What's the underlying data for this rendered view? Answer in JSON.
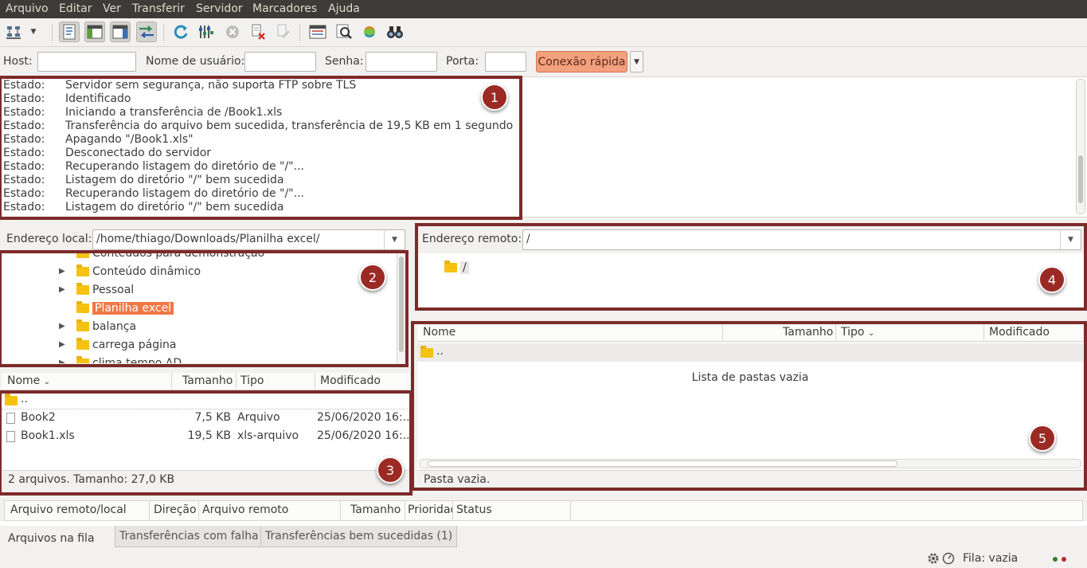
{
  "menu": [
    "Arquivo",
    "Editar",
    "Ver",
    "Transferir",
    "Servidor",
    "Marcadores",
    "Ajuda"
  ],
  "toolbar": {
    "buttons": [
      "site-manager",
      "dropdown",
      "toggle-log",
      "toggle-local-tree",
      "toggle-remote-tree",
      "toggle-queue",
      "refresh",
      "process-queue",
      "cancel",
      "disconnect",
      "reconnect",
      "dir-listing-filter",
      "compare",
      "sync-browse",
      "search"
    ]
  },
  "quickconnect": {
    "host_label": "Host:",
    "host_value": "",
    "user_label": "Nome de usuário:",
    "user_value": "",
    "pass_label": "Senha:",
    "pass_value": "",
    "port_label": "Porta:",
    "port_value": "",
    "button": "Conexão rápida"
  },
  "log": [
    {
      "k": "Estado:",
      "t": "Servidor sem segurança, não suporta FTP sobre TLS"
    },
    {
      "k": "Estado:",
      "t": "Identificado"
    },
    {
      "k": "Estado:",
      "t": "Iniciando a transferência de /Book1.xls"
    },
    {
      "k": "Estado:",
      "t": "Transferência do arquivo bem sucedida, transferência de 19,5 KB em 1 segundo"
    },
    {
      "k": "Estado:",
      "t": "Apagando \"/Book1.xls\""
    },
    {
      "k": "Estado:",
      "t": "Desconectado do servidor"
    },
    {
      "k": "Estado:",
      "t": "Recuperando listagem do diretório de \"/\"..."
    },
    {
      "k": "Estado:",
      "t": "Listagem do diretório \"/\" bem sucedida"
    },
    {
      "k": "Estado:",
      "t": "Recuperando listagem do diretório de \"/\"..."
    },
    {
      "k": "Estado:",
      "t": "Listagem do diretório \"/\" bem sucedida"
    }
  ],
  "local": {
    "address_label": "Endereço local:",
    "address_value": "/home/thiago/Downloads/Planilha excel/",
    "tree": [
      {
        "label": "Conteúdos para demonstração",
        "arrow": false,
        "selected": false
      },
      {
        "label": "Conteúdo dinâmico",
        "arrow": true,
        "selected": false
      },
      {
        "label": "Pessoal",
        "arrow": true,
        "selected": false
      },
      {
        "label": "Planilha excel",
        "arrow": false,
        "selected": true
      },
      {
        "label": "balança",
        "arrow": true,
        "selected": false
      },
      {
        "label": "carrega página",
        "arrow": true,
        "selected": false
      },
      {
        "label": "clima tempo AD",
        "arrow": true,
        "selected": false
      }
    ],
    "columns": [
      "Nome",
      "Tamanho",
      "Tipo",
      "Modificado"
    ],
    "files": [
      {
        "name": "..",
        "size": "",
        "type": "",
        "modified": "",
        "kind": "folder"
      },
      {
        "name": "Book2",
        "size": "7,5 KB",
        "type": "Arquivo",
        "modified": "25/06/2020 16:...",
        "kind": "file"
      },
      {
        "name": "Book1.xls",
        "size": "19,5 KB",
        "type": "xls-arquivo",
        "modified": "25/06/2020 16:...",
        "kind": "file"
      }
    ],
    "status": "2 arquivos. Tamanho: 27,0 KB"
  },
  "remote": {
    "address_label": "Endereço remoto:",
    "address_value": "/",
    "tree_root": "/",
    "columns": [
      "Nome",
      "Tamanho",
      "Tipo",
      "Modificado"
    ],
    "files": [
      {
        "name": "..",
        "kind": "folder"
      }
    ],
    "empty_message": "Lista de pastas vazia",
    "status": "Pasta vazia."
  },
  "annotations": [
    "1",
    "2",
    "3",
    "4",
    "5"
  ],
  "queue": {
    "columns": [
      "Arquivo remoto/local",
      "Direção",
      "Arquivo remoto",
      "Tamanho",
      "Prioridade",
      "Status"
    ],
    "tabs": [
      "Arquivos na fila",
      "Transferências com falha",
      "Transferências bem sucedidas (1)"
    ]
  },
  "statusbar": {
    "queue": "Fila: vazia"
  },
  "colors": {
    "menubar": "#3c3b37",
    "accent_selection": "#f07746",
    "annotation": "#7d2a2a",
    "badge": "#9b2a25"
  }
}
